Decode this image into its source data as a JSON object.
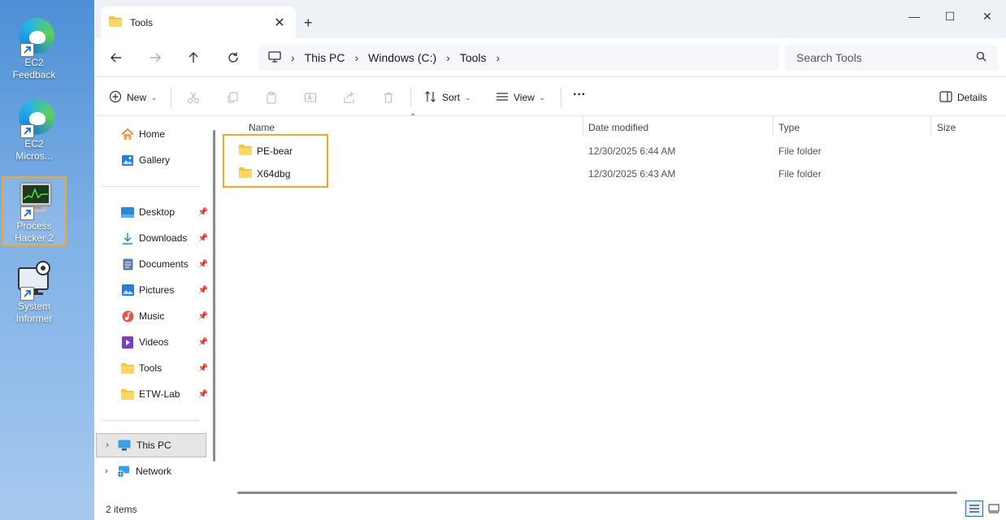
{
  "desktop": {
    "icons": [
      {
        "label_line1": "EC2",
        "label_line2": "Feedback"
      },
      {
        "label_line1": "EC2",
        "label_line2": "Micros..."
      },
      {
        "label_line1": "Process",
        "label_line2": "Hacker 2"
      },
      {
        "label_line1": "System",
        "label_line2": "Informer"
      }
    ]
  },
  "window": {
    "tab_title": "Tools",
    "tab_close": "✕",
    "new_tab": "+",
    "controls": {
      "minimize": "—",
      "maximize": "☐",
      "close": "✕"
    }
  },
  "address": {
    "crumbs": [
      "This PC",
      "Windows (C:)",
      "Tools"
    ],
    "search_placeholder": "Search Tools"
  },
  "toolbar": {
    "new_label": "New",
    "sort_label": "Sort",
    "view_label": "View",
    "more_label": "···",
    "details_label": "Details"
  },
  "sidebar": {
    "top": [
      {
        "label": "Home"
      },
      {
        "label": "Gallery"
      }
    ],
    "quick": [
      {
        "label": "Desktop"
      },
      {
        "label": "Downloads"
      },
      {
        "label": "Documents"
      },
      {
        "label": "Pictures"
      },
      {
        "label": "Music"
      },
      {
        "label": "Videos"
      },
      {
        "label": "Tools"
      },
      {
        "label": "ETW-Lab"
      }
    ],
    "tree": [
      {
        "label": "This PC"
      },
      {
        "label": "Network"
      }
    ]
  },
  "columns": {
    "name": "Name",
    "date": "Date modified",
    "type": "Type",
    "size": "Size"
  },
  "files": [
    {
      "name": "PE-bear",
      "date": "12/30/2025 6:44 AM",
      "type": "File folder"
    },
    {
      "name": "X64dbg",
      "date": "12/30/2025 6:43 AM",
      "type": "File folder"
    }
  ],
  "status": {
    "count": "2 items"
  },
  "colors": {
    "accent": "#f5a623",
    "folder": "#f4c542",
    "selection": "#1b6ec2"
  }
}
